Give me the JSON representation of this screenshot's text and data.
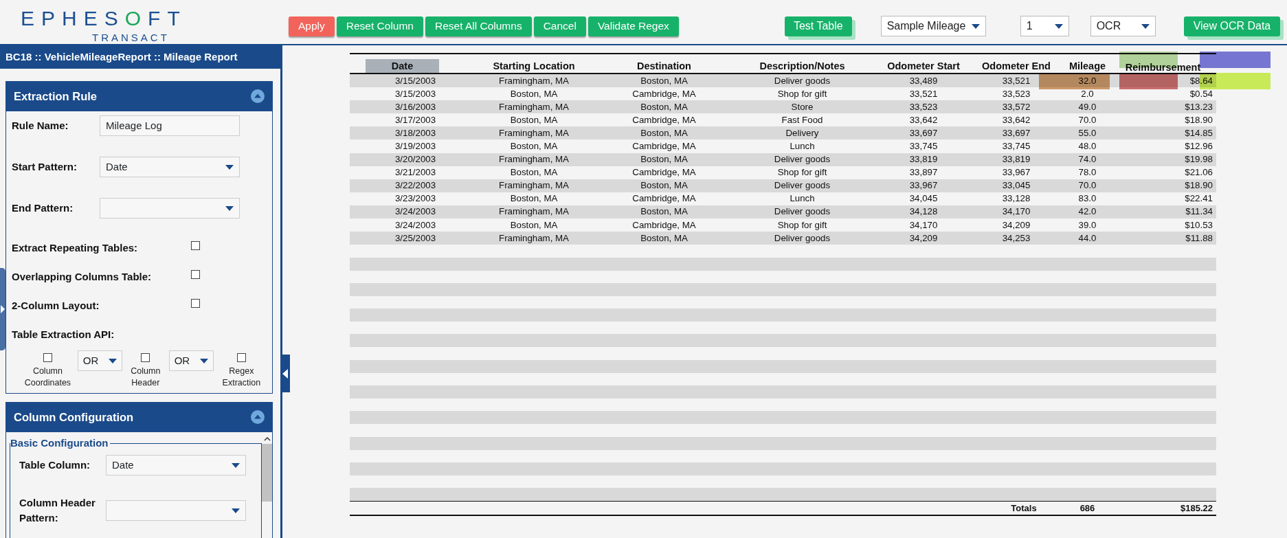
{
  "header": {
    "logo": {
      "name": "EPHESOFT",
      "sub": "TRANSACT"
    },
    "actions": [
      {
        "label": "Apply",
        "kind": "danger"
      },
      {
        "label": "Reset Column",
        "kind": "primary"
      },
      {
        "label": "Reset All Columns",
        "kind": "primary"
      },
      {
        "label": "Cancel",
        "kind": "primary"
      },
      {
        "label": "Validate Regex",
        "kind": "primary"
      }
    ],
    "test_button": "Test Table",
    "selects": [
      {
        "value": "Sample Mileage"
      },
      {
        "value": "1"
      },
      {
        "value": "OCR"
      }
    ],
    "view_button": "View OCR Data"
  },
  "panel": {
    "title": "BC18 :: VehicleMileageReport :: Mileage Report",
    "extraction_rule": {
      "title": "Extraction Rule",
      "expanded": true,
      "fields": [
        {
          "label": "Rule Name:",
          "kind": "input",
          "value": "Mileage Log"
        },
        {
          "label": "Start Pattern:",
          "kind": "select",
          "value": "Date"
        },
        {
          "label": "End Pattern:",
          "kind": "select"
        }
      ],
      "options": [
        {
          "label": "Extract Repeating Tables:",
          "checked": false
        },
        {
          "label": "Overlapping Columns Table:",
          "checked": false
        },
        {
          "label": "2-Column Layout:",
          "checked": false
        }
      ],
      "api_label": "Table Extraction API:",
      "api_options": [
        {
          "label": "Column Coordinates",
          "checked": false
        },
        {
          "label": "Column Header",
          "checked": false
        },
        {
          "label": "Regex Extraction",
          "checked": false
        }
      ],
      "operators": [
        "OR",
        "OR"
      ]
    },
    "column_configuration": {
      "title": "Column Configuration",
      "expanded": true,
      "group": "Basic Configuration",
      "fields": [
        {
          "label": "Table Column:",
          "value": "Date"
        },
        {
          "label": "Column Header Pattern:"
        }
      ]
    }
  },
  "document": {
    "columns": [
      {
        "label": "Date",
        "selected": true
      },
      {
        "label": "Starting Location",
        "selected": false
      },
      {
        "label": "Destination",
        "selected": false
      },
      {
        "label": "Description/Notes",
        "selected": false
      },
      {
        "label": "Odometer Start",
        "selected": false
      },
      {
        "label": "Odometer End",
        "selected": false
      },
      {
        "label": "Mileage",
        "selected": false
      },
      {
        "label": "Reimbursement",
        "selected": false
      }
    ],
    "rows": [
      [
        "3/15/2003",
        "Framingham, MA",
        "Boston, MA",
        "Deliver goods",
        "33,489",
        "33,521",
        "32.0",
        "$8.64"
      ],
      [
        "3/15/2003",
        "Boston, MA",
        "Cambridge, MA",
        "Shop for gift",
        "33,521",
        "33,523",
        "2.0",
        "$0.54"
      ],
      [
        "3/16/2003",
        "Framingham, MA",
        "Boston, MA",
        "Store",
        "33,523",
        "33,572",
        "49.0",
        "$13.23"
      ],
      [
        "3/17/2003",
        "Boston, MA",
        "Cambridge, MA",
        "Fast Food",
        "33,642",
        "33,642",
        "70.0",
        "$18.90"
      ],
      [
        "3/18/2003",
        "Framingham, MA",
        "Boston, MA",
        "Delivery",
        "33,697",
        "33,697",
        "55.0",
        "$14.85"
      ],
      [
        "3/19/2003",
        "Boston, MA",
        "Cambridge, MA",
        "Lunch",
        "33,745",
        "33,745",
        "48.0",
        "$12.96"
      ],
      [
        "3/20/2003",
        "Framingham, MA",
        "Boston, MA",
        "Deliver goods",
        "33,819",
        "33,819",
        "74.0",
        "$19.98"
      ],
      [
        "3/21/2003",
        "Boston, MA",
        "Cambridge, MA",
        "Shop for gift",
        "33,897",
        "33,967",
        "78.0",
        "$21.06"
      ],
      [
        "3/22/2003",
        "Framingham, MA",
        "Boston, MA",
        "Deliver goods",
        "33,967",
        "33,045",
        "70.0",
        "$18.90"
      ],
      [
        "3/23/2003",
        "Boston, MA",
        "Cambridge, MA",
        "Lunch",
        "34,045",
        "33,128",
        "83.0",
        "$22.41"
      ],
      [
        "3/24/2003",
        "Framingham, MA",
        "Boston, MA",
        "Deliver goods",
        "34,128",
        "34,170",
        "42.0",
        "$11.34"
      ],
      [
        "3/24/2003",
        "Boston, MA",
        "Cambridge, MA",
        "Shop for gift",
        "34,170",
        "34,209",
        "39.0",
        "$10.53"
      ],
      [
        "3/25/2003",
        "Framingham, MA",
        "Boston, MA",
        "Deliver goods",
        "34,209",
        "34,253",
        "44.0",
        "$11.88"
      ]
    ],
    "totals": {
      "label": "Totals",
      "mileage": "686",
      "reimbursement": "$185.22"
    },
    "regions": [
      {
        "color": "#b8dba0"
      },
      {
        "color": "#7b7bdc"
      },
      {
        "color": "#d4a06e"
      },
      {
        "color": "#d47474"
      },
      {
        "color": "#d1f55c"
      }
    ]
  }
}
